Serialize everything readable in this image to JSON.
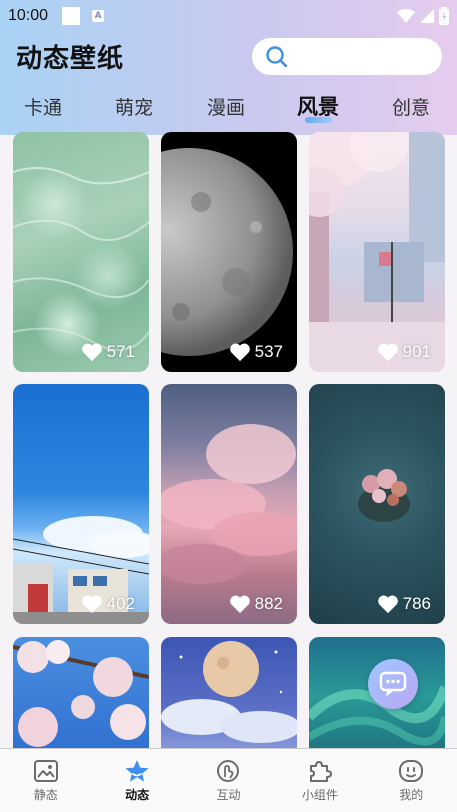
{
  "status_bar": {
    "time": "10:00",
    "input_badge": "A"
  },
  "header": {
    "title": "动态壁纸",
    "search_placeholder": ""
  },
  "tabs": [
    {
      "label": "卡通"
    },
    {
      "label": "萌宠"
    },
    {
      "label": "漫画"
    },
    {
      "label": "风景"
    },
    {
      "label": "创意"
    }
  ],
  "active_tab": "风景",
  "wallpapers": [
    {
      "subject": "water ripples",
      "likes": "571"
    },
    {
      "subject": "moon",
      "likes": "537"
    },
    {
      "subject": "cherry blossom street",
      "likes": "901"
    },
    {
      "subject": "anime town under blue sky",
      "likes": "402"
    },
    {
      "subject": "pink clouds",
      "likes": "882"
    },
    {
      "subject": "flower island in ocean",
      "likes": "786"
    },
    {
      "subject": "cherry blossoms",
      "likes": ""
    },
    {
      "subject": "full moon over clouds",
      "likes": ""
    },
    {
      "subject": "aurora",
      "likes": ""
    }
  ],
  "bottom_nav": [
    {
      "label": "静态",
      "icon": "image-icon"
    },
    {
      "label": "动态",
      "icon": "star-icon"
    },
    {
      "label": "互动",
      "icon": "touch-icon"
    },
    {
      "label": "小组件",
      "icon": "puzzle-icon"
    },
    {
      "label": "我的",
      "icon": "smile-face-icon"
    }
  ],
  "colors": {
    "accent": "#4a9cf0",
    "nav_active": "#3f8ff0"
  }
}
